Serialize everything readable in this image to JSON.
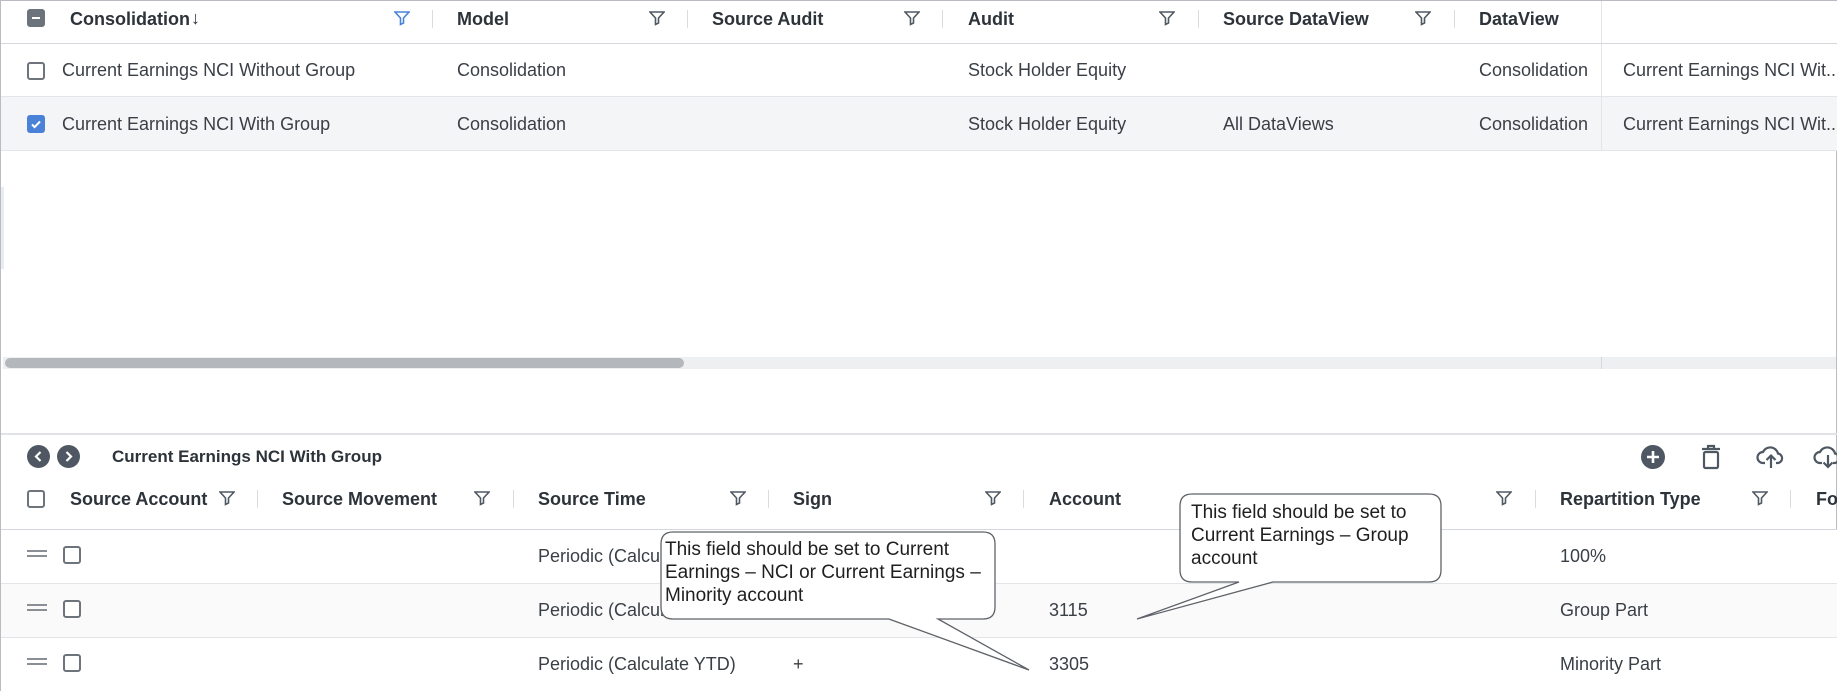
{
  "top_grid": {
    "columns": [
      {
        "label": "Consolidation",
        "sort_indicator": "↓"
      },
      {
        "label": "Model"
      },
      {
        "label": "Source Audit"
      },
      {
        "label": "Audit"
      },
      {
        "label": "Source DataView"
      },
      {
        "label": "DataView"
      }
    ],
    "rows": [
      {
        "checked": false,
        "consolidation": "Current Earnings NCI Without Group",
        "model": "Consolidation",
        "source_audit": "",
        "audit": "Stock Holder Equity",
        "source_dataview": "",
        "dataview": "Consolidation",
        "extra": "Current Earnings NCI Wit..."
      },
      {
        "checked": true,
        "consolidation": "Current Earnings NCI With Group",
        "model": "Consolidation",
        "source_audit": "",
        "audit": "Stock Holder Equity",
        "source_dataview": "All DataViews",
        "dataview": "Consolidation",
        "extra": "Current Earnings NCI Wit..."
      }
    ],
    "scrollbar_thumb_fraction": 0.37
  },
  "detail": {
    "title": "Current Earnings NCI With Group",
    "nav": {
      "prev_icon": "chevron-left-icon",
      "next_icon": "chevron-right-icon"
    },
    "toolbar_icons": [
      "add-circle-icon",
      "delete-trash-icon",
      "upload-cloud-icon",
      "download-cloud-icon"
    ],
    "columns": [
      {
        "label": "Source Account"
      },
      {
        "label": "Source Movement"
      },
      {
        "label": "Source Time"
      },
      {
        "label": "Sign"
      },
      {
        "label": "Account"
      },
      {
        "label": "Repartition Type"
      },
      {
        "label": "Fo"
      }
    ],
    "rows": [
      {
        "source_time": "Periodic (Calcu",
        "sign": "",
        "account": "",
        "repartition": "100%"
      },
      {
        "source_time": "Periodic (Calcul",
        "sign": "",
        "account": "3115",
        "repartition": "Group Part"
      },
      {
        "source_time": "Periodic (Calculate YTD)",
        "sign": "+",
        "account": "3305",
        "repartition": "Minority Part"
      }
    ]
  },
  "callouts": {
    "nci": "This field should be set to Current Earnings – NCI or Current Earnings – Minority account",
    "group": "This field should be set to Current  Earnings – Group account"
  },
  "colors": {
    "accent": "#4a82d8",
    "icon": "#505963",
    "selected_row": "#f4f5f7"
  }
}
